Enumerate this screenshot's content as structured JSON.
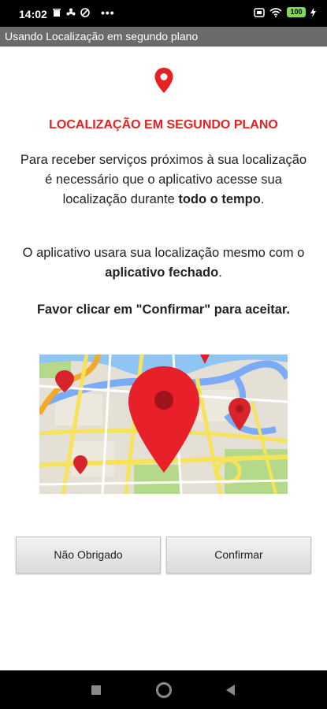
{
  "status_bar": {
    "time": "14:02",
    "battery": "100",
    "icons": [
      "trash-icon",
      "fan-icon",
      "no-disturb-icon",
      "more-dots-icon",
      "screen-share-icon",
      "wifi-icon",
      "battery-icon",
      "charging-icon"
    ],
    "dots": "•••"
  },
  "title_bar": {
    "title": "Usando Localização em segundo plano"
  },
  "main": {
    "heading": "LOCALIZAÇÃO EM SEGUNDO PLANO",
    "paragraph1_a": "Para receber serviços próximos à sua localização é necessário que o aplicativo acesse sua localização durante ",
    "paragraph1_bold": "todo o tempo",
    "paragraph1_end": ".",
    "paragraph2_a": "O aplicativo usara sua localização mesmo com o ",
    "paragraph2_bold": "aplicativo fechado",
    "paragraph2_end": ".",
    "paragraph3": "Favor clicar em \"Confirmar\" para aceitar.",
    "map_icon": "map-with-pins",
    "accent_color": "#e8201f"
  },
  "buttons": {
    "decline": "Não Obrigado",
    "confirm": "Confirmar"
  },
  "nav_bar": {
    "icons": [
      "recent-apps-icon",
      "home-icon",
      "back-icon"
    ]
  }
}
